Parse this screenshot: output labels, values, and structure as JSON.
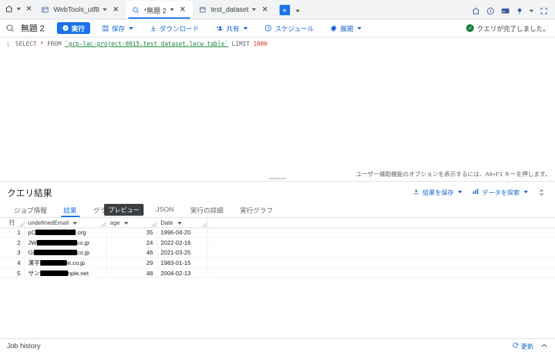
{
  "browser": {
    "home_icon": "home-icon",
    "tabs": [
      {
        "label": "WebTools_utf8",
        "icon": "grid-icon",
        "active": false
      },
      {
        "label": "*無題 2",
        "icon": "bigquery-icon",
        "active": true
      },
      {
        "label": "test_dataset",
        "icon": "window-icon",
        "active": false
      }
    ],
    "new_tab_label": "+",
    "right_icons": [
      "home-icon",
      "info-icon",
      "card-icon",
      "pin-icon",
      "fullscreen-icon"
    ]
  },
  "toolbar": {
    "search_icon": "search-icon",
    "title": "無題 2",
    "run_label": "実行",
    "save_label": "保存",
    "download_label": "ダウンロード",
    "share_label": "共有",
    "schedule_label": "スケジュール",
    "expand_label": "展開",
    "status_text": "クエリが完了しました。",
    "status_color": "#188038",
    "accent_color": "#1a73e8"
  },
  "editor": {
    "line_number": "1",
    "sql": {
      "select": "SELECT",
      "star": "*",
      "from": "FROM",
      "table": "`gcp-lac-project-0015.test_dataset.lacw_table`",
      "limit": "LIMIT",
      "limit_value": "1000"
    },
    "a11y_hint": "ユーザー補助機能のオプションを表示するには、Alt+F1 キーを押します。"
  },
  "results": {
    "title": "クエリ結果",
    "save_results_label": "結果を保存",
    "explore_data_label": "データを探索",
    "tabs": [
      {
        "label": "ジョブ情報",
        "active": false
      },
      {
        "label": "結果",
        "active": true
      },
      {
        "label": "グラフ",
        "active": false
      },
      {
        "label": "JSON",
        "active": false
      },
      {
        "label": "実行の詳細",
        "active": false
      },
      {
        "label": "実行グラフ",
        "active": false
      }
    ],
    "tooltip": "プレビュー",
    "columns": [
      "行",
      "undefinedEmail",
      "age",
      "Date"
    ],
    "rows": [
      {
        "row": "1",
        "email_prefix": "pC",
        "email_suffix": ".org",
        "redact_width": 58,
        "age": "35",
        "date": "1996-04-20"
      },
      {
        "row": "2",
        "email_prefix": "JW",
        "email_suffix": "co.jp",
        "redact_width": 58,
        "age": "24",
        "date": "2022-02-16"
      },
      {
        "row": "3",
        "email_prefix": "Gi",
        "email_suffix": "co.jp",
        "redact_width": 62,
        "age": "46",
        "date": "2021-03-25"
      },
      {
        "row": "4",
        "email_prefix": "漢字",
        "email_suffix": "le.co.jp",
        "redact_width": 38,
        "age": "29",
        "date": "1983-01-15"
      },
      {
        "row": "5",
        "email_prefix": "サン",
        "email_suffix": "nple.net",
        "redact_width": 40,
        "age": "48",
        "date": "2004-02-13"
      }
    ]
  },
  "footer": {
    "title": "Job history",
    "refresh_label": "更新"
  }
}
